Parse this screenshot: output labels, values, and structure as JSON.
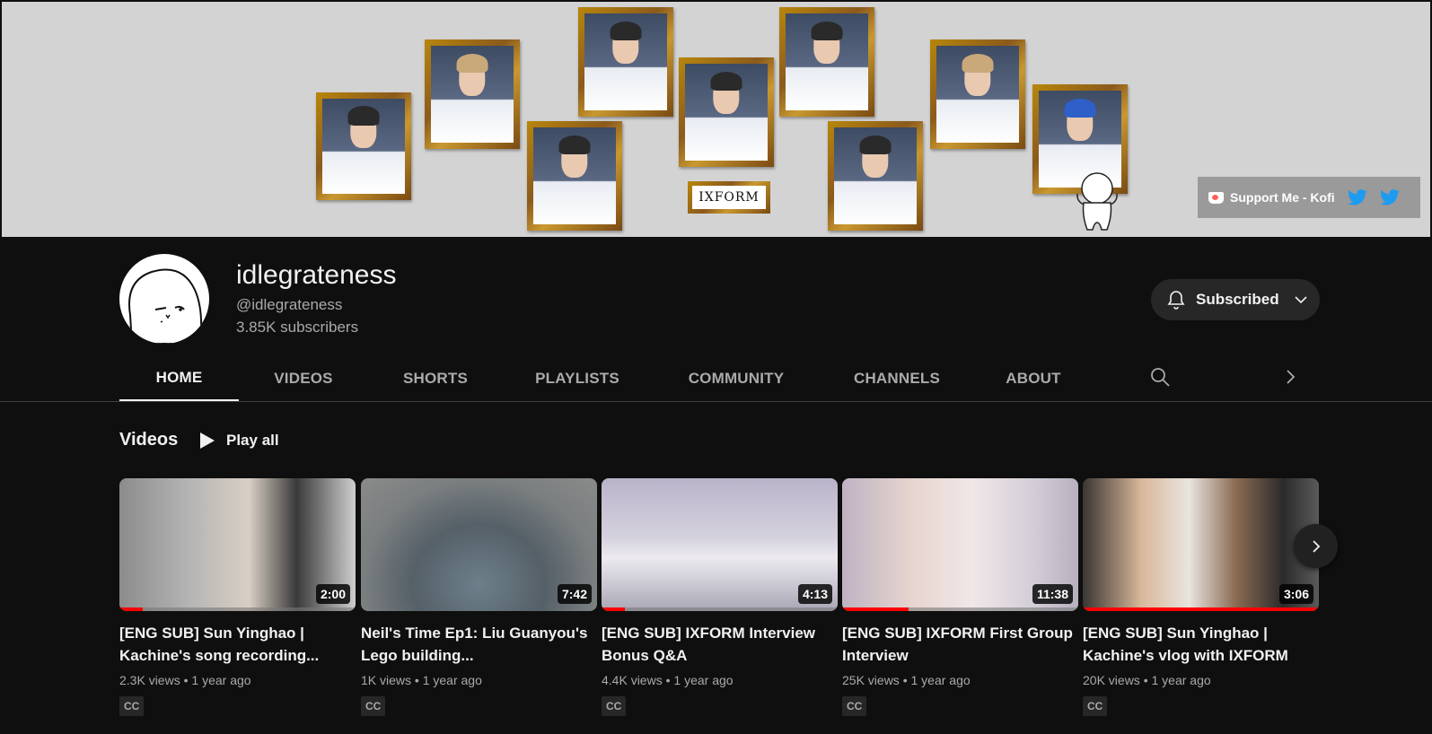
{
  "banner": {
    "plaque_text": "IXFORM",
    "support_label": "Support Me - Kofi"
  },
  "channel": {
    "name": "idlegrateness",
    "handle": "@idlegrateness",
    "subscribers": "3.85K subscribers",
    "subscribe_label": "Subscribed"
  },
  "tabs": [
    {
      "label": "HOME",
      "active": true
    },
    {
      "label": "VIDEOS"
    },
    {
      "label": "SHORTS"
    },
    {
      "label": "PLAYLISTS"
    },
    {
      "label": "COMMUNITY"
    },
    {
      "label": "CHANNELS"
    },
    {
      "label": "ABOUT"
    }
  ],
  "videos_section": {
    "title": "Videos",
    "play_all_label": "Play all",
    "items": [
      {
        "title": "[ENG SUB] Sun Yinghao | Kachine's song recording...",
        "duration": "2:00",
        "views": "2.3K views",
        "age": "1 year ago",
        "badge": "CC",
        "progress": 0.1
      },
      {
        "title": "Neil's Time Ep1: Liu Guanyou's Lego building...",
        "duration": "7:42",
        "views": "1K views",
        "age": "1 year ago",
        "badge": "CC",
        "progress": 0
      },
      {
        "title": "[ENG SUB] IXFORM Interview Bonus Q&A",
        "duration": "4:13",
        "views": "4.4K views",
        "age": "1 year ago",
        "badge": "CC",
        "progress": 0.1
      },
      {
        "title": "[ENG SUB] IXFORM First Group Interview",
        "duration": "11:38",
        "views": "25K views",
        "age": "1 year ago",
        "badge": "CC",
        "progress": 0.28
      },
      {
        "title": "[ENG SUB] Sun Yinghao | Kachine's vlog with IXFORM",
        "duration": "3:06",
        "views": "20K views",
        "age": "1 year ago",
        "badge": "CC",
        "progress": 1.0
      }
    ]
  },
  "colors": {
    "background": "#0f0f0f",
    "progress": "#ff0000",
    "twitter": "#1d9bf0",
    "banner_bg": "#d3d3d3"
  }
}
